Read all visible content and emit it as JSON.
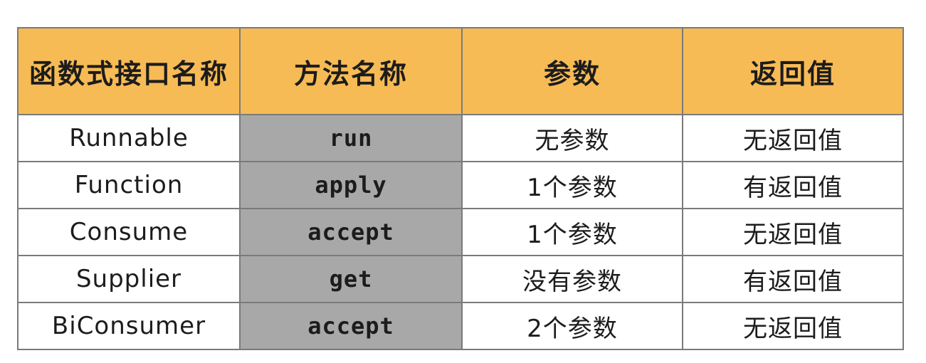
{
  "colors": {
    "header_bg": "#f7bb55",
    "method_col_bg": "#a8a8a8",
    "cell_bg": "#ffffff",
    "border": "#7a7a7a"
  },
  "table": {
    "headers": [
      "函数式接口名称",
      "方法名称",
      "参数",
      "返回值"
    ],
    "rows": [
      [
        "Runnable",
        "run",
        "无参数",
        "无返回值"
      ],
      [
        "Function",
        "apply",
        "1个参数",
        "有返回值"
      ],
      [
        "Consume",
        "accept",
        "1个参数",
        "无返回值"
      ],
      [
        "Supplier",
        "get",
        "没有参数",
        "有返回值"
      ],
      [
        "BiConsumer",
        "accept",
        "2个参数",
        "无返回值"
      ]
    ]
  }
}
